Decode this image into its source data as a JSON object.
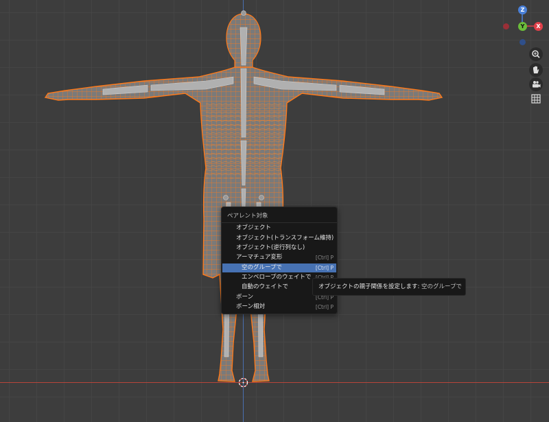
{
  "menu": {
    "title": "ペアレント対象",
    "items": [
      {
        "label": "オブジェクト",
        "shortcut": ""
      },
      {
        "label": "オブジェクト(トランスフォーム維持)",
        "shortcut": ""
      },
      {
        "label": "オブジェクト(逆行列なし)",
        "shortcut": ""
      },
      {
        "label": "アーマチュア変形",
        "shortcut": "[Ctrl] P"
      },
      {
        "label": "空のグループで",
        "shortcut": "[Ctrl] P"
      },
      {
        "label": "エンベロープのウェイトで",
        "shortcut": "[Ctrl] P"
      },
      {
        "label": "自動のウェイトで",
        "shortcut": ""
      },
      {
        "label": "ボーン",
        "shortcut": "[Ctrl] P"
      },
      {
        "label": "ボーン相対",
        "shortcut": "[Ctrl] P"
      }
    ]
  },
  "tooltip": {
    "text": "オブジェクトの親子関係を設定します:",
    "detail": "空のグループで"
  },
  "gizmo": {
    "z": "Z",
    "y": "Y",
    "x": "X"
  },
  "colors": {
    "accent": "#4772b3",
    "mesh": "#ff7a1a",
    "x_axis": "#b8453a",
    "z_axis": "#4a6fb0",
    "viewport": "#3d3d3d"
  },
  "icons": [
    "zoom-icon",
    "hand-pan-icon",
    "camera-icon",
    "grid-ortho-icon"
  ]
}
